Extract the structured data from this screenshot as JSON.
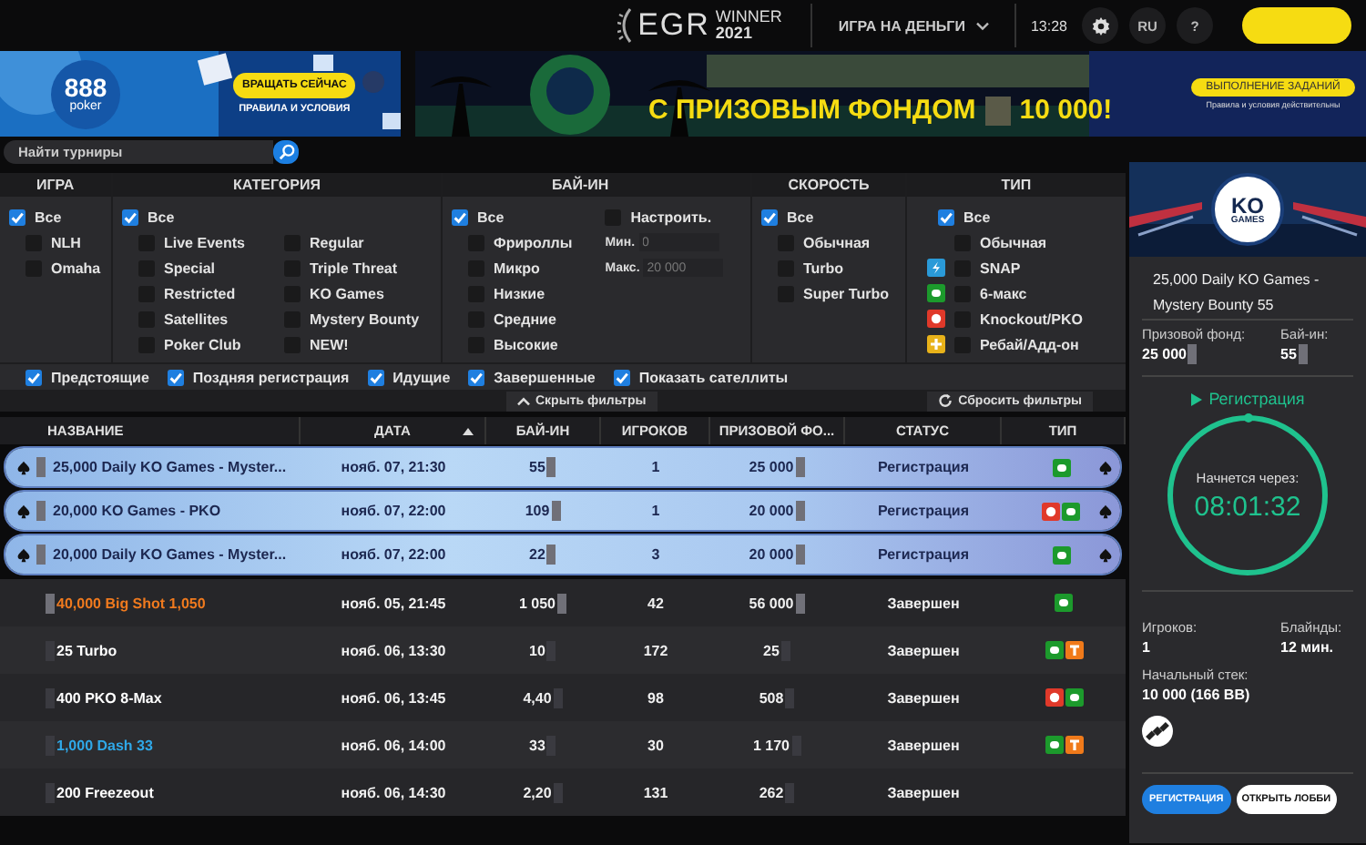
{
  "header": {
    "award": {
      "brand": "EGR",
      "title": "WINNER",
      "year": "2021"
    },
    "mode": "ИГРА НА ДЕНЬГИ",
    "time": "13:28",
    "language": "RU",
    "help": "?"
  },
  "promo_banner": {
    "logo": [
      "888",
      "poker"
    ],
    "button": "ВРАЩАТЬ СЕЙЧАС",
    "link": "ПРАВИЛА И УСЛОВИЯ"
  },
  "offer_banner": {
    "headline": "С ПРИЗОВЫМ ФОНДОМ",
    "amount": "10 000!",
    "button": "ВЫПОЛНЕНИЕ ЗАДАНИЙ",
    "note": "Правила и условия действительны"
  },
  "search": {
    "placeholder": "Найти турниры"
  },
  "currency_masked": true,
  "filters": {
    "groups": [
      {
        "kind": "list",
        "title": "ИГРА",
        "options": [
          {
            "label": "Все",
            "checked": true
          },
          {
            "label": "NLH",
            "checked": false
          },
          {
            "label": "Omaha",
            "checked": false
          }
        ]
      },
      {
        "kind": "grid",
        "title": "КАТЕГОРИЯ",
        "options": [
          {
            "label": "Все",
            "checked": true
          },
          {
            "label": "Live Events",
            "checked": false
          },
          {
            "label": "Special",
            "checked": false
          },
          {
            "label": "Restricted",
            "checked": false
          },
          {
            "label": "Satellites",
            "checked": false
          },
          {
            "label": "Poker Club",
            "checked": false
          },
          {
            "label": "Regular",
            "checked": false
          },
          {
            "label": "Triple Threat",
            "checked": false
          },
          {
            "label": "KO Games",
            "checked": false
          },
          {
            "label": "Mystery Bounty",
            "checked": false
          },
          {
            "label": "NEW!",
            "checked": false
          }
        ]
      },
      {
        "kind": "range",
        "title": "БАЙ-ИН",
        "options": [
          {
            "label": "Все",
            "checked": true
          },
          {
            "label": "Фрироллы",
            "checked": false
          },
          {
            "label": "Микро",
            "checked": false
          },
          {
            "label": "Низкие",
            "checked": false
          },
          {
            "label": "Средние",
            "checked": false
          },
          {
            "label": "Высокие",
            "checked": false
          }
        ],
        "custom": {
          "label": "Настроить.",
          "checked": false,
          "min_label": "Мин.",
          "min": "0",
          "max_label": "Макс.",
          "max": "20 000"
        }
      },
      {
        "kind": "list",
        "title": "СКОРОСТЬ",
        "options": [
          {
            "label": "Все",
            "checked": true
          },
          {
            "label": "Обычная",
            "checked": false
          },
          {
            "label": "Turbo",
            "checked": false
          },
          {
            "label": "Super Turbo",
            "checked": false
          }
        ]
      },
      {
        "kind": "list",
        "title": "ТИП",
        "options": [
          {
            "label": "Все",
            "checked": true
          },
          {
            "label": "Обычная",
            "checked": false
          },
          {
            "label": "SNAP",
            "checked": false,
            "kind": "snap"
          },
          {
            "label": "6-макс",
            "checked": false,
            "kind": "sixmax"
          },
          {
            "label": "Knockout/PKO",
            "checked": false,
            "kind": "ko"
          },
          {
            "label": "Ребай/Адд-он",
            "checked": false,
            "kind": "rebuy"
          }
        ]
      }
    ],
    "toggles": [
      {
        "label": "Предстоящие",
        "checked": true
      },
      {
        "label": "Поздняя регистрация",
        "checked": true
      },
      {
        "label": "Идущие",
        "checked": true
      },
      {
        "label": "Завершенные",
        "checked": true
      },
      {
        "label": "Показать сателлиты",
        "checked": true
      }
    ],
    "hide_button": "Скрыть фильтры",
    "reset_button": "Сбросить фильтры"
  },
  "table": {
    "columns": [
      {
        "label": "НАЗВАНИЕ",
        "sorted": false
      },
      {
        "label": "ДАТА",
        "sorted": true
      },
      {
        "label": "БАЙ-ИН",
        "sorted": false
      },
      {
        "label": "ИГРОКОВ",
        "sorted": false
      },
      {
        "label": "ПРИЗОВОЙ ФО...",
        "sorted": false
      },
      {
        "label": "СТАТУС",
        "sorted": false
      },
      {
        "label": "ТИП",
        "sorted": false
      }
    ],
    "rows": [
      {
        "name": "25,000 Daily KO Games - Myster...",
        "color": "#1c2750",
        "date": "нояб. 07, 21:30",
        "buyin": "55",
        "players": "1",
        "prize": "25 000",
        "status": "Регистрация",
        "types": [
          {
            "kind": "sixmax"
          }
        ],
        "selected": true
      },
      {
        "name": "20,000 KO Games - PKO",
        "color": "#1c2750",
        "date": "нояб. 07, 22:00",
        "buyin": "109",
        "players": "1",
        "prize": "20 000",
        "status": "Регистрация",
        "types": [
          {
            "kind": "ko"
          },
          {
            "kind": "sixmax"
          }
        ],
        "selected": true
      },
      {
        "name": "20,000 Daily KO Games - Myster...",
        "color": "#1c2750",
        "date": "нояб. 07, 22:00",
        "buyin": "22",
        "players": "3",
        "prize": "20 000",
        "status": "Регистрация",
        "types": [
          {
            "kind": "sixmax"
          }
        ],
        "selected": true
      },
      {
        "name": "40,000 Big Shot 1,050",
        "color": "#f07a1e",
        "date": "нояб. 05, 21:45",
        "buyin": "1 050",
        "players": "42",
        "prize": "56 000",
        "status": "Завершен",
        "types": [
          {
            "kind": "sixmax"
          }
        ],
        "selected": false
      },
      {
        "name": "25 Turbo",
        "color": "#ffffff",
        "date": "нояб. 06, 13:30",
        "buyin": "10",
        "players": "172",
        "prize": "25",
        "status": "Завершен",
        "types": [
          {
            "kind": "sixmax"
          },
          {
            "kind": "turbo"
          }
        ],
        "selected": false
      },
      {
        "name": "400 PKO 8-Max",
        "color": "#ffffff",
        "date": "нояб. 06, 13:45",
        "buyin": "4,40",
        "players": "98",
        "prize": "508",
        "status": "Завершен",
        "types": [
          {
            "kind": "ko"
          },
          {
            "kind": "sixmax"
          }
        ],
        "selected": false
      },
      {
        "name": "1,000 Dash 33",
        "color": "#2fa8e8",
        "date": "нояб. 06, 14:00",
        "buyin": "33",
        "players": "30",
        "prize": "1 170",
        "status": "Завершен",
        "types": [
          {
            "kind": "sixmax"
          },
          {
            "kind": "turbo"
          }
        ],
        "selected": false
      },
      {
        "name": "200 Freezeout",
        "color": "#ffffff",
        "date": "нояб. 06, 14:30",
        "buyin": "2,20",
        "players": "131",
        "prize": "262",
        "status": "Завершен",
        "selected": false
      }
    ]
  },
  "detail": {
    "logo": [
      "KO",
      "GAMES"
    ],
    "title": "25,000 Daily KO Games - Mystery Bounty 55",
    "prize_label": "Призовой фонд:",
    "prize": "25 000",
    "buyin_label": "Бай-ин:",
    "buyin": "55",
    "status": "Регистрация",
    "countdown_label": "Начнется через:",
    "countdown": "08:01:32",
    "players_label": "Игроков:",
    "players": "1",
    "blinds_label": "Блайнды:",
    "blinds": "12 мин.",
    "stack_label": "Начальный стек:",
    "stack": "10 000 (166 BB)",
    "register_button": "РЕГИСТРАЦИЯ",
    "lobby_button": "ОТКРЫТЬ ЛОББИ"
  }
}
